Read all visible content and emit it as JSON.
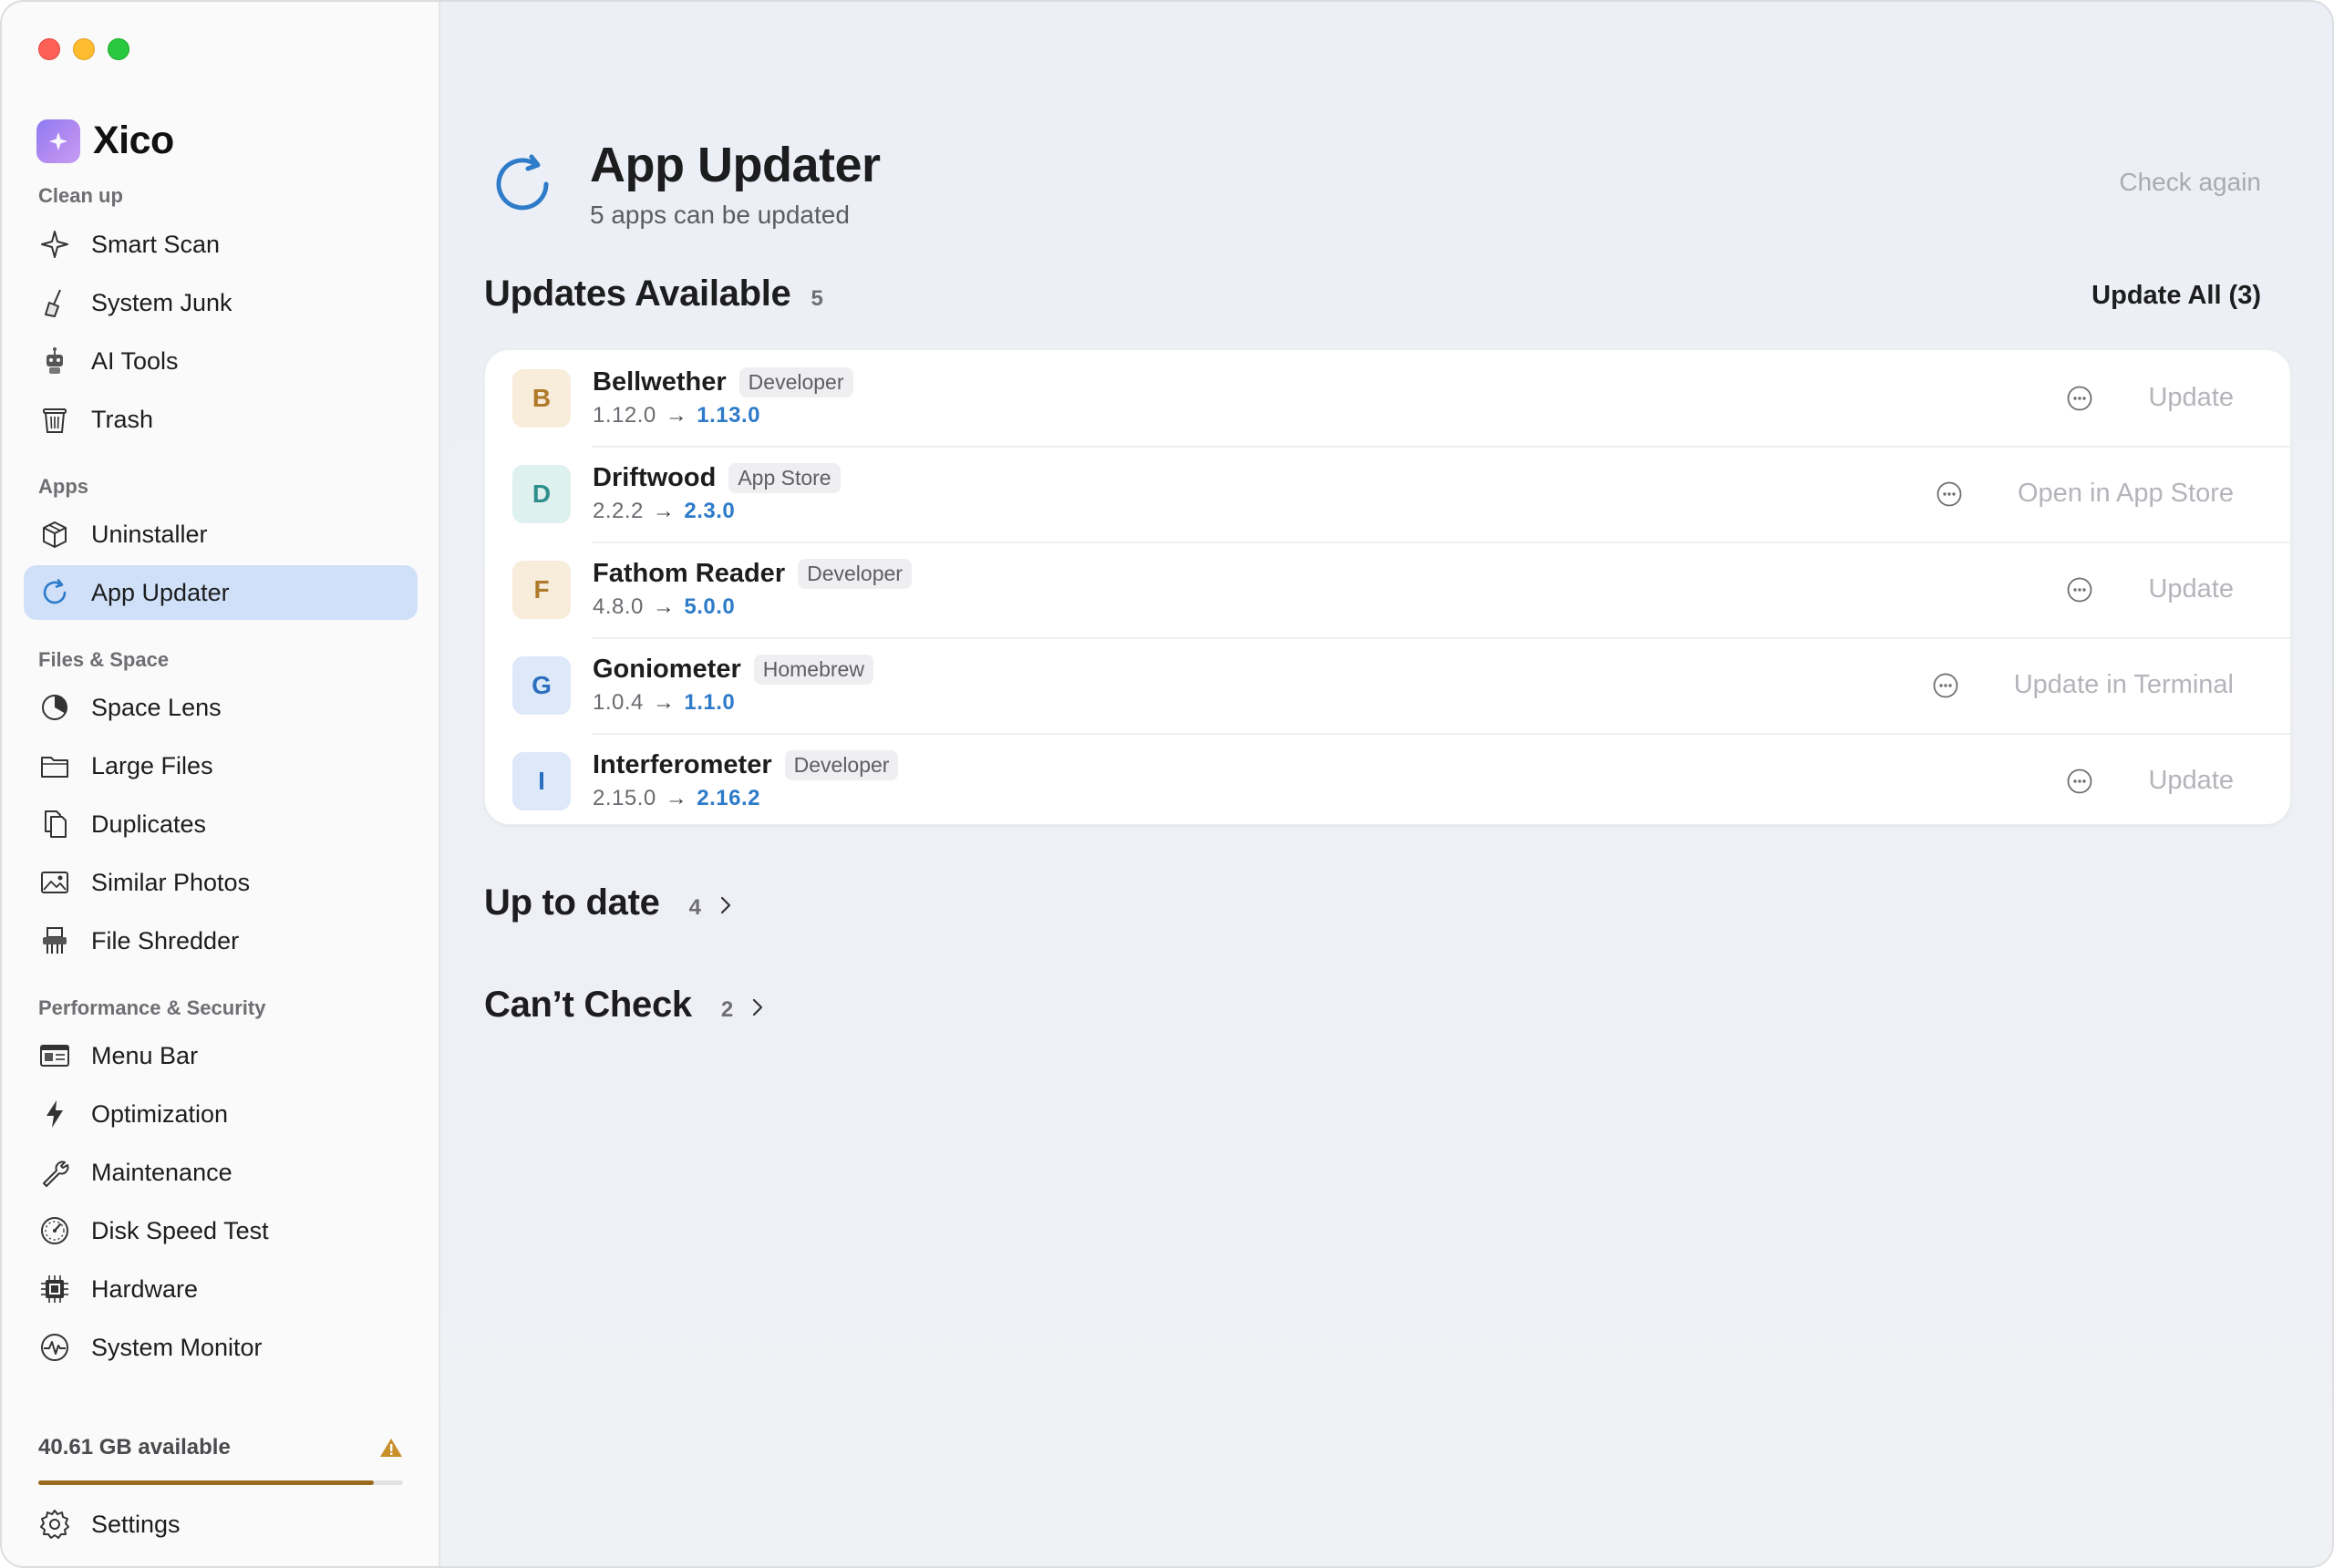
{
  "app": {
    "name": "Xico"
  },
  "sidebar": {
    "sections": [
      {
        "title": "Clean up",
        "items": [
          {
            "label": "Smart Scan",
            "icon": "sparkle-icon"
          },
          {
            "label": "System Junk",
            "icon": "broom-icon"
          },
          {
            "label": "AI Tools",
            "icon": "robot-icon"
          },
          {
            "label": "Trash",
            "icon": "trash-icon"
          }
        ]
      },
      {
        "title": "Apps",
        "items": [
          {
            "label": "Uninstaller",
            "icon": "box-icon"
          },
          {
            "label": "App Updater",
            "icon": "refresh-icon",
            "active": true
          }
        ]
      },
      {
        "title": "Files & Space",
        "items": [
          {
            "label": "Space Lens",
            "icon": "pie-icon"
          },
          {
            "label": "Large Files",
            "icon": "folder-icon"
          },
          {
            "label": "Duplicates",
            "icon": "duplicate-icon"
          },
          {
            "label": "Similar Photos",
            "icon": "photo-icon"
          },
          {
            "label": "File Shredder",
            "icon": "shredder-icon"
          }
        ]
      },
      {
        "title": "Performance & Security",
        "items": [
          {
            "label": "Menu Bar",
            "icon": "menubar-icon"
          },
          {
            "label": "Optimization",
            "icon": "bolt-icon"
          },
          {
            "label": "Maintenance",
            "icon": "wrench-icon"
          },
          {
            "label": "Disk Speed Test",
            "icon": "gauge-icon"
          },
          {
            "label": "Hardware",
            "icon": "chip-icon"
          },
          {
            "label": "System Monitor",
            "icon": "pulse-icon"
          }
        ]
      }
    ],
    "storage": {
      "text": "40.61 GB available",
      "used_fraction": 0.92,
      "warning_icon": "warning-icon"
    },
    "settings": {
      "label": "Settings",
      "icon": "gear-icon"
    }
  },
  "header": {
    "title": "App Updater",
    "subtitle": "5 apps can be updated",
    "check_again": "Check again"
  },
  "updates": {
    "title": "Updates Available",
    "count": "5",
    "update_all": "Update All (3)",
    "apps": [
      {
        "initial": "B",
        "name": "Bellwether",
        "source": "Developer",
        "from": "1.12.0",
        "to": "1.13.0",
        "action": "Update",
        "avatar_bg": "#f8ecdb",
        "avatar_fg": "#b07a2b"
      },
      {
        "initial": "D",
        "name": "Driftwood",
        "source": "App Store",
        "from": "2.2.2",
        "to": "2.3.0",
        "action": "Open in App Store",
        "avatar_bg": "#dff1ef",
        "avatar_fg": "#2f8f8a"
      },
      {
        "initial": "F",
        "name": "Fathom Reader",
        "source": "Developer",
        "from": "4.8.0",
        "to": "5.0.0",
        "action": "Update",
        "avatar_bg": "#f8ecdb",
        "avatar_fg": "#b07a2b"
      },
      {
        "initial": "G",
        "name": "Goniometer",
        "source": "Homebrew",
        "from": "1.0.4",
        "to": "1.1.0",
        "action": "Update in Terminal",
        "avatar_bg": "#dde9f8",
        "avatar_fg": "#2d6fbf"
      },
      {
        "initial": "I",
        "name": "Interferometer",
        "source": "Developer",
        "from": "2.15.0",
        "to": "2.16.2",
        "action": "Update",
        "avatar_bg": "#dde9f8",
        "avatar_fg": "#2d6fbf"
      }
    ]
  },
  "up_to_date": {
    "title": "Up to date",
    "count": "4"
  },
  "cant_check": {
    "title": "Can’t Check",
    "count": "2"
  },
  "colors": {
    "accent": "#2d7bc9",
    "active_nav": "#cfe0f8",
    "storage_bar": "#9a6a1c"
  }
}
